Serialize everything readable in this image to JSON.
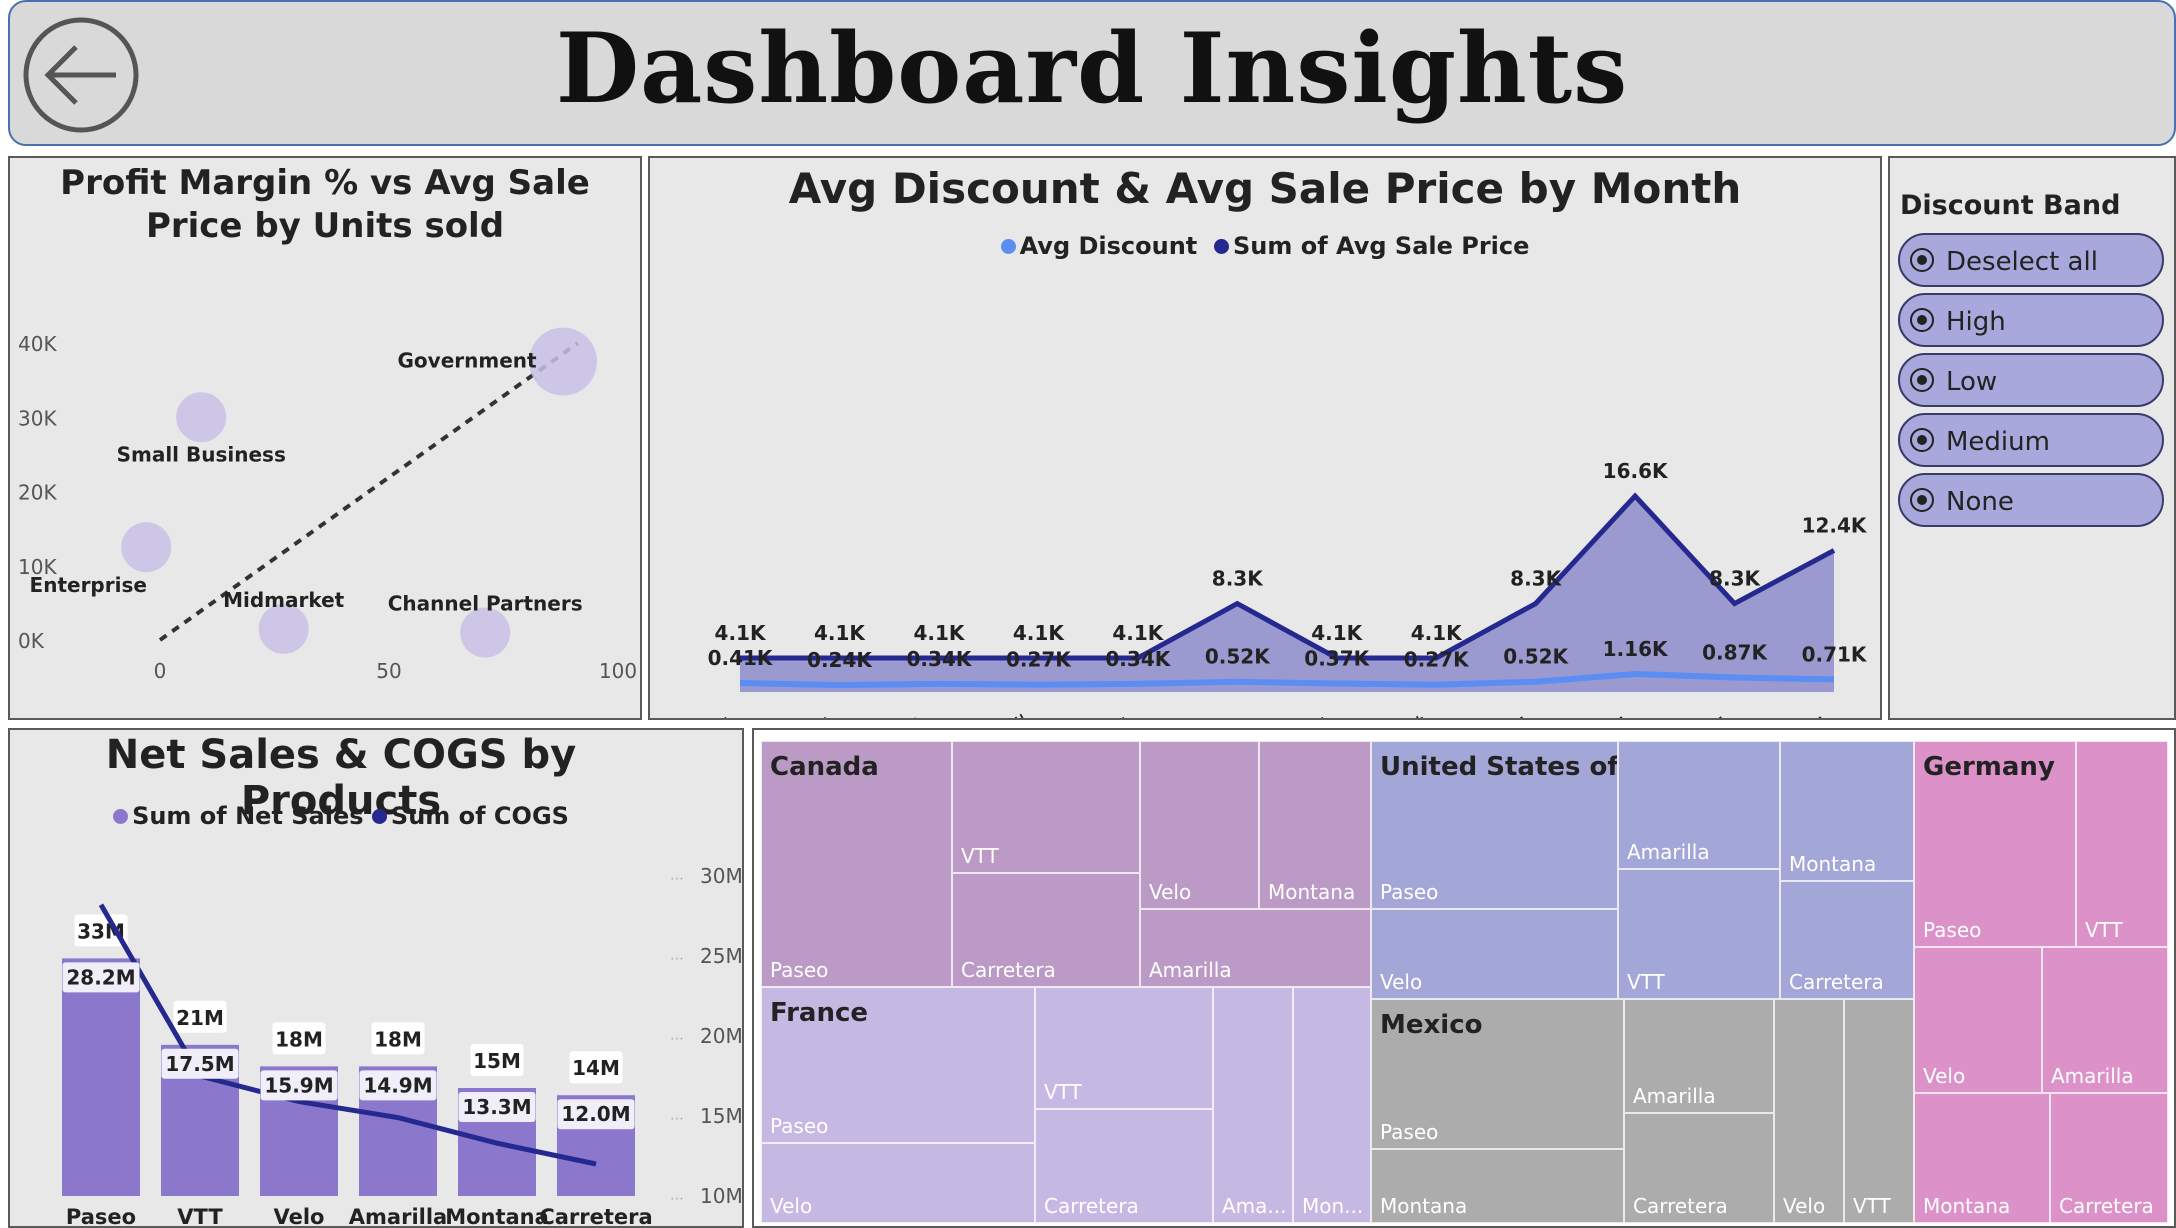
{
  "header": {
    "title": "Dashboard Insights",
    "back_icon": "arrow-left-icon"
  },
  "scatter": {
    "title": "Profit Margin % vs Avg Sale Price by Units sold",
    "chart_data": {
      "type": "scatter",
      "title": "Profit Margin % vs Avg Sale Price by Units sold",
      "xlim": [
        0,
        100
      ],
      "ylim": [
        0,
        40000
      ],
      "x_ticks": [
        "0",
        "50",
        "100"
      ],
      "y_ticks": [
        "0K",
        "10K",
        "20K",
        "30K",
        "40K"
      ],
      "trend_line": true,
      "points": [
        {
          "label": "Government",
          "x": 88,
          "y": 37500,
          "size": 1.0
        },
        {
          "label": "Small Business",
          "x": 9,
          "y": 30000,
          "size": 0.55
        },
        {
          "label": "Enterprise",
          "x": -3,
          "y": 12500,
          "size": 0.55
        },
        {
          "label": "Midmarket",
          "x": 27,
          "y": 1500,
          "size": 0.55
        },
        {
          "label": "Channel Partners",
          "x": 71,
          "y": 1000,
          "size": 0.55
        }
      ],
      "color": "#c9bfe6"
    }
  },
  "monthly": {
    "title": "Avg Discount & Avg Sale Price by Month",
    "legend": [
      {
        "name": "Avg Discount",
        "color": "#5b8ef5"
      },
      {
        "name": "Sum of Avg Sale Price",
        "color": "#25288f"
      }
    ],
    "chart_data": {
      "type": "area",
      "title": "Avg Discount & Avg Sale Price by Month",
      "categories": [
        "January",
        "February",
        "March",
        "April",
        "May",
        "June",
        "July",
        "August",
        "September",
        "October",
        "November",
        "December"
      ],
      "series": [
        {
          "name": "Sum of Avg Sale Price",
          "values": [
            4100,
            4100,
            4100,
            4100,
            4100,
            8300,
            4100,
            4100,
            8300,
            16600,
            8300,
            12400
          ],
          "labels": [
            "4.1K",
            "4.1K",
            "4.1K",
            "4.1K",
            "4.1K",
            "8.3K",
            "4.1K",
            "4.1K",
            "8.3K",
            "16.6K",
            "8.3K",
            "12.4K"
          ],
          "color": "#25288f",
          "fill": "#9a9ad0"
        },
        {
          "name": "Avg Discount",
          "values": [
            410,
            240,
            340,
            270,
            340,
            520,
            370,
            270,
            520,
            1160,
            870,
            710
          ],
          "labels": [
            "0.41K",
            "0.24K",
            "0.34K",
            "0.27K",
            "0.34K",
            "0.52K",
            "0.37K",
            "0.27K",
            "0.52K",
            "1.16K",
            "0.87K",
            "0.71K"
          ],
          "color": "#5b8ef5"
        }
      ]
    }
  },
  "slicer": {
    "title": "Discount Band",
    "items": [
      "Deselect all",
      "High",
      "Low",
      "Medium",
      "None"
    ],
    "radio_icon": "radio-selected-icon"
  },
  "products": {
    "title": "Net Sales & COGS by Products",
    "legend": [
      {
        "name": "Sum of Net Sales",
        "color": "#8b78cc"
      },
      {
        "name": "Sum of COGS",
        "color": "#25288f"
      }
    ],
    "chart_data": {
      "type": "bar",
      "title": "Net Sales & COGS by Products",
      "categories": [
        "Paseo",
        "VTT",
        "Velo",
        "Amarilla",
        "Montana",
        "Carretera"
      ],
      "ylim": [
        10,
        30
      ],
      "y_ticks": [
        "30M",
        "25M",
        "20M",
        "15M",
        "10M"
      ],
      "series": [
        {
          "name": "Sum of Net Sales",
          "values": [
            33,
            21,
            18,
            18,
            15,
            14
          ],
          "labels": [
            "33M",
            "21M",
            "18M",
            "18M",
            "15M",
            "14M"
          ],
          "color": "#8b78cc"
        },
        {
          "name": "Sum of COGS",
          "values": [
            28.2,
            17.5,
            15.9,
            14.9,
            13.3,
            12.0
          ],
          "labels": [
            "28.2M",
            "17.5M",
            "15.9M",
            "14.9M",
            "13.3M",
            "12.0M"
          ],
          "color": "#25288f"
        }
      ]
    }
  },
  "treemap": {
    "groups": [
      {
        "country": "Canada",
        "color": "#bb9ac6",
        "products": [
          "Paseo",
          "VTT",
          "Carretera",
          "Velo",
          "Montana",
          "Amarilla"
        ]
      },
      {
        "country": "United States of America",
        "color": "#a3a7d8",
        "products": [
          "Paseo",
          "Velo",
          "Amarilla",
          "VTT",
          "Montana",
          "Carretera"
        ]
      },
      {
        "country": "Germany",
        "color": "#dc92c8",
        "products": [
          "Paseo",
          "VTT",
          "Velo",
          "Amarilla",
          "Montana",
          "Carretera"
        ]
      },
      {
        "country": "France",
        "color": "#c5b8e2",
        "products": [
          "Paseo",
          "Velo",
          "VTT",
          "Carretera",
          "Ama...",
          "Mon..."
        ]
      },
      {
        "country": "Mexico",
        "color": "#acacac",
        "products": [
          "Paseo",
          "Montana",
          "Amarilla",
          "Carretera",
          "Velo",
          "VTT"
        ]
      }
    ]
  }
}
